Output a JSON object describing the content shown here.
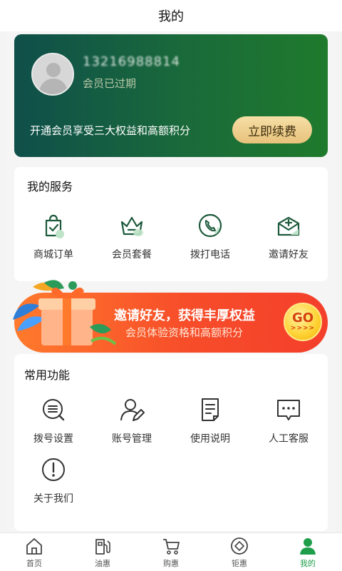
{
  "header": {
    "title": "我的"
  },
  "member": {
    "phone": "13216988814",
    "status": "会员已过期",
    "promo": "开通会员享受三大权益和高额积分",
    "renew_label": "立即续费"
  },
  "services": {
    "title": "我的服务",
    "items": [
      {
        "label": "商城订单",
        "icon": "shopping-bag-icon"
      },
      {
        "label": "会员套餐",
        "icon": "crown-icon"
      },
      {
        "label": "拨打电话",
        "icon": "phone-icon"
      },
      {
        "label": "邀请好友",
        "icon": "mail-icon"
      }
    ]
  },
  "banner": {
    "title": "邀请好友，获得丰厚权益",
    "subtitle": "会员体验资格和高额积分",
    "go_label": "GO",
    "go_arrows": ">>>>"
  },
  "functions": {
    "title": "常用功能",
    "items": [
      {
        "label": "拨号设置",
        "icon": "list-search-icon"
      },
      {
        "label": "账号管理",
        "icon": "user-edit-icon"
      },
      {
        "label": "使用说明",
        "icon": "document-icon"
      },
      {
        "label": "人工客服",
        "icon": "chat-icon"
      },
      {
        "label": "关于我们",
        "icon": "info-icon"
      }
    ]
  },
  "nav": {
    "items": [
      {
        "label": "首页",
        "icon": "home-icon"
      },
      {
        "label": "油惠",
        "icon": "fuel-pump-icon"
      },
      {
        "label": "购惠",
        "icon": "cart-icon"
      },
      {
        "label": "钜惠",
        "icon": "diamond-icon"
      },
      {
        "label": "我的",
        "icon": "user-icon",
        "active": true
      }
    ],
    "active_color": "#1e9e4a"
  },
  "colors": {
    "accent_green": "#1e9e4a",
    "card_gradient_start": "#0f4f4a",
    "card_gradient_end": "#1f7a2c",
    "banner_orange": "#f74d2a",
    "gold": "#e7c27b"
  }
}
